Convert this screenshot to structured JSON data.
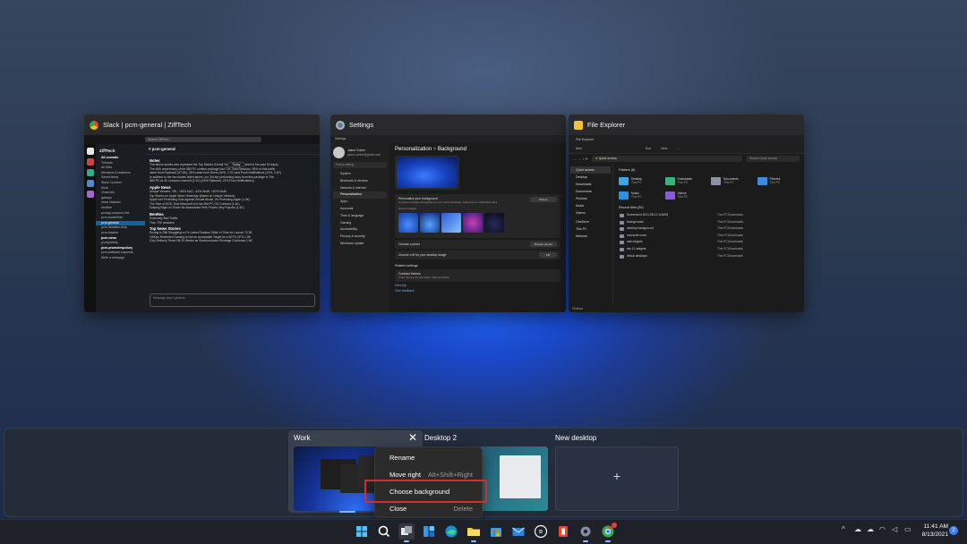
{
  "windows": {
    "slack": {
      "title": "Slack | pcm-general | ZiffTech",
      "search": "Search ZiffTech",
      "workspace": "ZiffTech",
      "channel": "# pcm-general",
      "day": "Today",
      "sidebar": [
        "All unreads",
        "Threads",
        "All DMs",
        "Mentions & reactions",
        "Saved items",
        "Slack Connect",
        "More",
        "Channels",
        "galaxyx",
        "news features",
        "nerdfire",
        "pcmag-coupons-link",
        "pcm-bookerfom",
        "pcm-general",
        "pcm-headline-help",
        "pcm-howtos",
        "pcm-news",
        "pcmrydehity",
        "pcm-promotespotury",
        "pcm-software-requests",
        "Write a message"
      ],
      "messages": [
        {
          "name": "Notes",
          "lines": [
            "The above stories also represent the Top Stories Overall Yesterday (published in the past 30 days).",
            "The 40th anniversary of the IBM PC content package had 72K Total Sessions. 89% of that traffic",
            "came from Flipboard (57.8K), 28% came from Direct (16%, 3.7K) and Push Notifications (12%, 2.4K).",
            "In addition to the two stories listed above, our 3rd top performing story from this package is The",
            "IBM PC at 40: Lessons Learned (2.1K) (43% Flipboard, 21% Push Notifications)"
          ]
        },
        {
          "name": "Apple News",
          "lines": [
            "Unique Viewers: 33K, +48% DoD, -43% WoW, +40% MoM",
            "Top Stories on Apple News Yesterday (based on Unique Viewers)",
            "Apple Isn't Protecting Kids Against Sexual Abuse, It's Protecting Apple (1.4K)",
            "The Rise of DOS: How Microsoft Got the IBM PC OS Contract (1.4K)",
            "Swiping Right on Tinder for Abandoned Pets Proves Very Popular (1.4K)"
          ]
        },
        {
          "name": "BenRea",
          "lines": [
            "Extremely Bad Traffic",
            "This: 79K sessions"
          ]
        },
        {
          "name": "Top News Stories",
          "lines": [
            "Roxing Is Still Struggling to Fix Latest Rootkee Glitch in Time for Launch 70.3K",
            "1000ps Restricted Gaming Is Not an Acceptable Target for a 607% GPU 1.9K",
            "Chip Delivery Times Hit 20 Weeks as Semiconductor Shortage Continues 1.6K"
          ]
        }
      ],
      "input_placeholder": "Message #pcm-general"
    },
    "settings": {
      "title": "Settings",
      "app_label": "Settings",
      "user_name": "Jason Cohen",
      "user_email": "jason.cohen@gmail.com",
      "find": "Find a setting",
      "nav": [
        "System",
        "Bluetooth & devices",
        "Network & internet",
        "Personalization",
        "Apps",
        "Accounts",
        "Time & language",
        "Gaming",
        "Accessibility",
        "Privacy & security",
        "Windows Update"
      ],
      "heading": "Personalization",
      "heading_sep": ">",
      "subheading": "Background",
      "bg_label": "Personalize your background",
      "bg_desc": "A picture background applies to your current desktop. Solid color or slideshow backgrounds apply to all your desktops.",
      "bg_value": "Picture",
      "recent_images": "Recent images",
      "choose_photo": "Choose a photo",
      "browse": "Browse photos",
      "choose_fit": "Choose a fit for your desktop image",
      "fit_value": "Fill",
      "related": "Related settings",
      "contrast": "Contrast themes",
      "contrast_desc": "Color themes for low vision, light sensitivity",
      "get_help": "Get help",
      "give_feedback": "Give feedback"
    },
    "explorer": {
      "title": "File Explorer",
      "app_label": "File Explorer",
      "commands": [
        "New",
        "Sort",
        "View",
        "..."
      ],
      "address": "Quick access",
      "search": "Search Quick access",
      "nav": [
        "Quick access",
        "Desktop",
        "Downloads",
        "Documents",
        "Pictures",
        "Music",
        "Videos",
        "OneDrive",
        "This PC",
        "Network"
      ],
      "folders_heading": "Folders (6)",
      "folders": [
        {
          "name": "Desktop",
          "loc": "This PC"
        },
        {
          "name": "Downloads",
          "loc": "This PC"
        },
        {
          "name": "Documents",
          "loc": "This PC"
        },
        {
          "name": "Pictures",
          "loc": "This PC"
        },
        {
          "name": "Music",
          "loc": "This PC"
        },
        {
          "name": "Videos",
          "loc": "This PC"
        }
      ],
      "recent_heading": "Recent files (20)",
      "recent": [
        {
          "name": "Screenshot 2021-08-13 115405",
          "loc": "This PC\\Downloads"
        },
        {
          "name": "backgrounds",
          "loc": "This PC\\Downloads"
        },
        {
          "name": "desktop background",
          "loc": "This PC\\Downloads"
        },
        {
          "name": "microsoft news",
          "loc": "This PC\\Downloads"
        },
        {
          "name": "add widgets",
          "loc": "This PC\\Downloads"
        },
        {
          "name": "win 11 widgets",
          "loc": "This PC\\Downloads"
        },
        {
          "name": "virtual desktops",
          "loc": "This PC\\Downloads"
        }
      ],
      "status": "26 items"
    }
  },
  "desktops": [
    {
      "label": "Work",
      "selected": true
    },
    {
      "label": "Desktop 2",
      "selected": false
    },
    {
      "label": "New desktop",
      "selected": false
    }
  ],
  "new_desktop_plus": "+",
  "close_glyph": "✕",
  "context_menu": [
    {
      "label": "Rename",
      "shortcut": ""
    },
    {
      "label": "Move right",
      "shortcut": "Alt+Shift+Right"
    },
    {
      "label": "Choose background",
      "shortcut": ""
    },
    {
      "label": "Close",
      "shortcut": "Delete"
    }
  ],
  "taskbar": {
    "apps": [
      "start-icon",
      "search-icon",
      "task-view-icon",
      "widgets-icon",
      "edge-icon",
      "file-explorer-icon",
      "store-icon",
      "mail-icon",
      "dell-icon",
      "office-icon",
      "settings-icon",
      "chrome-icon"
    ],
    "clock_time": "11:41 AM",
    "clock_date": "8/13/2021",
    "notification_count": "2"
  },
  "colors": {
    "accent": "#3b82f6",
    "highlight_box": "#d32f2f",
    "slack_active": "#1164a3"
  }
}
